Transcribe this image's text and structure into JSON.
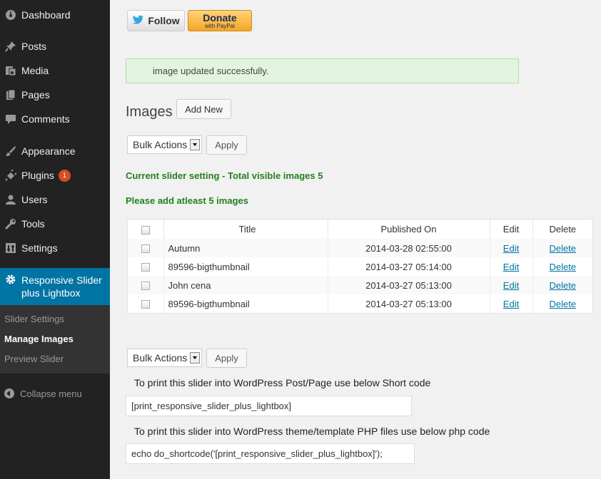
{
  "sidebar": {
    "items": [
      {
        "label": "Dashboard",
        "icon": "dashboard-icon"
      },
      {
        "label": "Posts",
        "icon": "pin-icon"
      },
      {
        "label": "Media",
        "icon": "media-icon"
      },
      {
        "label": "Pages",
        "icon": "pages-icon"
      },
      {
        "label": "Comments",
        "icon": "comment-icon"
      },
      {
        "label": "Appearance",
        "icon": "brush-icon"
      },
      {
        "label": "Plugins",
        "icon": "plug-icon",
        "badge": "1"
      },
      {
        "label": "Users",
        "icon": "user-icon"
      },
      {
        "label": "Tools",
        "icon": "wrench-icon"
      },
      {
        "label": "Settings",
        "icon": "settings-icon"
      }
    ],
    "current": {
      "label": "Responsive Slider plus Lightbox",
      "icon": "gear-icon"
    },
    "submenu": [
      "Slider Settings",
      "Manage Images",
      "Preview Slider"
    ],
    "collapse": "Collapse menu"
  },
  "top_buttons": {
    "follow": "Follow",
    "donate": "Donate",
    "donate_sub": "with PayPal"
  },
  "notice": "image updated successfully.",
  "images_title": "Images",
  "add_new": "Add New",
  "bulk_actions": "Bulk Actions",
  "apply": "Apply",
  "slider_setting": "Current slider setting - Total visible images 5",
  "please_add": "Please add atleast 5 images",
  "table": {
    "headers": [
      "Title",
      "Published On",
      "Edit",
      "Delete"
    ],
    "rows": [
      {
        "title": "Autumn",
        "date": "2014-03-28 02:55:00",
        "edit": "Edit",
        "delete": "Delete"
      },
      {
        "title": "89596-bigthumbnail",
        "date": "2014-03-27 05:14:00",
        "edit": "Edit",
        "delete": "Delete"
      },
      {
        "title": "John cena",
        "date": "2014-03-27 05:13:00",
        "edit": "Edit",
        "delete": "Delete"
      },
      {
        "title": "89596-bigthumbnail",
        "date": "2014-03-27 05:13:00",
        "edit": "Edit",
        "delete": "Delete"
      }
    ]
  },
  "shortcode_label": "To print this slider into WordPress Post/Page use below Short code",
  "shortcode_value": "[print_responsive_slider_plus_lightbox]",
  "php_label": "To print this slider into WordPress theme/template PHP files use below php code",
  "php_value": "echo do_shortcode('[print_responsive_slider_plus_lightbox]');"
}
